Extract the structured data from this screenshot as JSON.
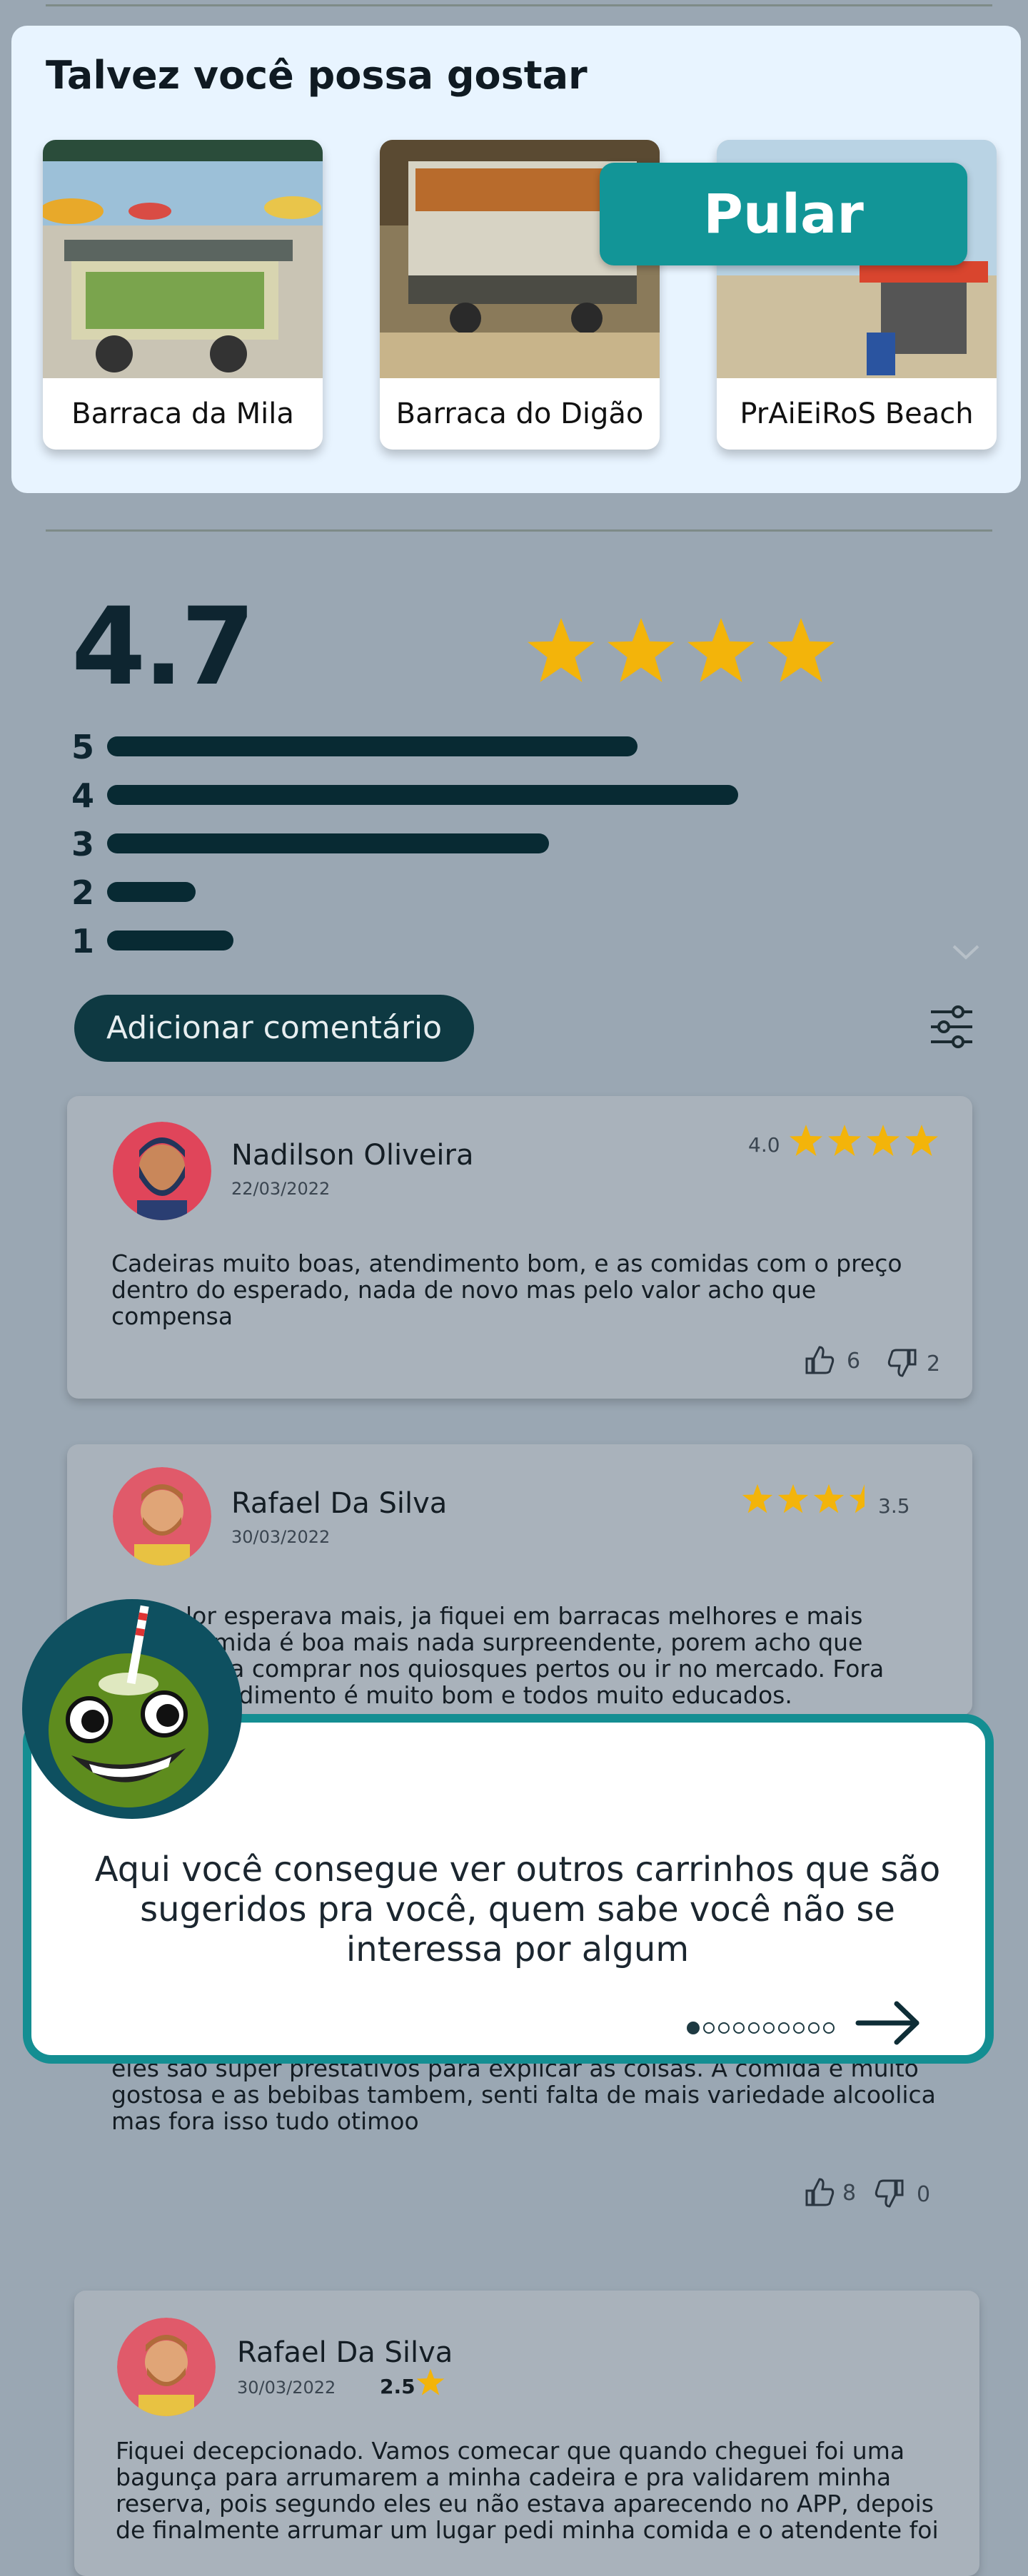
{
  "suggestions": {
    "title": "Talvez você possa gostar",
    "items": [
      {
        "name": "Barraca da Mila"
      },
      {
        "name": "Barraca do Digão"
      },
      {
        "name": "PrAiEiRoS Beach"
      }
    ],
    "skip_label": "Pular"
  },
  "rating": {
    "average": "4.7",
    "stars": 4.7,
    "distribution": [
      {
        "label": "5",
        "fraction": 0.84
      },
      {
        "label": "4",
        "fraction": 1.0
      },
      {
        "label": "3",
        "fraction": 0.7
      },
      {
        "label": "2",
        "fraction": 0.14
      },
      {
        "label": "1",
        "fraction": 0.2
      }
    ]
  },
  "actions": {
    "add_comment_label": "Adicionar comentário"
  },
  "reviews": [
    {
      "name": "Nadilson Oliveira",
      "date": "22/03/2022",
      "score": "4.0",
      "stars": 4.0,
      "text": "Cadeiras muito boas, atendimento bom, e as comidas com o preço dentro do esperado, nada de novo mas pelo valor acho que compensa",
      "likes": "6",
      "dislikes": "2"
    },
    {
      "name": "Rafael Da Silva",
      "date": "30/03/2022",
      "score": "3.5",
      "stars": 3.5,
      "text_visible_lines": [
        "lor esperava mais, ja fiquei em barracas melhores e mais",
        "comida é boa mais nada surpreendente, porem acho que",
        "pena comprar nos quiosques pertos ou ir no mercado. Fora",
        "atendimento é muito bom e todos muito educados."
      ]
    },
    {
      "text_visible_lines": [
        "eles são super prestativos para explicar as coisas. A comida é muito",
        "gostosa e as bebibas tambem, senti falta de mais variedade alcoolica",
        "mas fora isso tudo otimoo"
      ],
      "likes": "8",
      "dislikes": "0"
    },
    {
      "name": "Rafael Da Silva",
      "date": "30/03/2022",
      "score": "2.5",
      "stars": 2.5,
      "text_visible_lines": [
        "Fiquei decepcionado. Vamos comecar que quando cheguei foi uma",
        "bagunça para arrumarem a minha cadeira e pra validarem minha",
        "reserva, pois segundo eles eu não estava aparecendo no APP, depois",
        "de finalmente arrumar um lugar pedi minha comida e o atendente foi"
      ]
    }
  ],
  "tutorial": {
    "message": "Aqui você consegue ver outros carrinhos que são sugeridos pra você, quem sabe você não se interessa por algum",
    "total_steps": 10,
    "current_step": 1
  },
  "colors": {
    "accent": "#129597",
    "dark": "#0e3942",
    "star": "#f5b400"
  }
}
